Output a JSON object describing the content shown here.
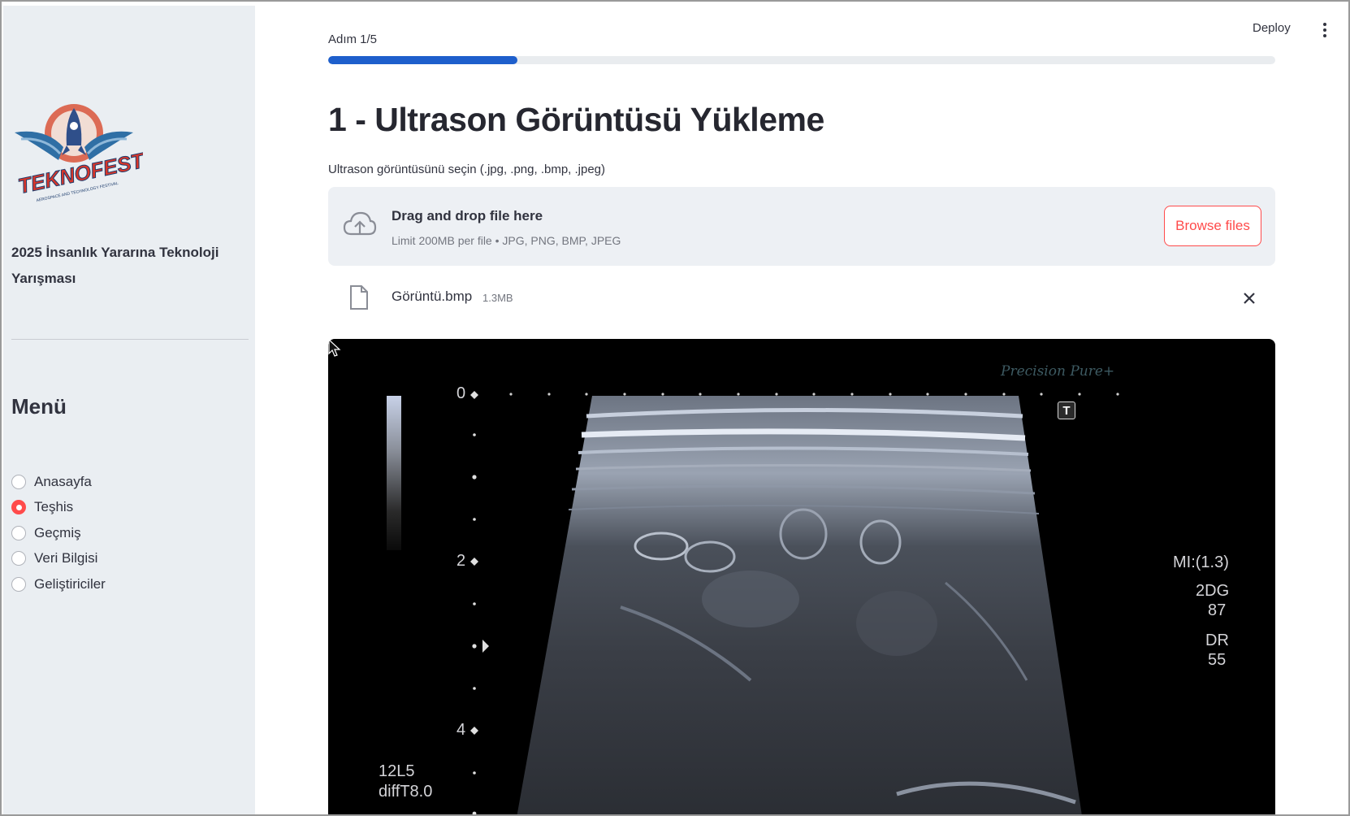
{
  "header": {
    "deploy_label": "Deploy",
    "menu_icon": "kebab-menu-icon"
  },
  "sidebar": {
    "logo_icon": "teknofest-logo-icon",
    "logo_text": "TEKNOFEST",
    "logo_subtext": "AEROSPACE AND TECHNOLOGY FESTIVAL",
    "title": "2025 İnsanlık Yararına Teknoloji Yarışması",
    "menu_title": "Menü",
    "menu_items": [
      {
        "label": "Anasayfa",
        "selected": false
      },
      {
        "label": "Teşhis",
        "selected": true
      },
      {
        "label": "Geçmiş",
        "selected": false
      },
      {
        "label": "Veri Bilgisi",
        "selected": false
      },
      {
        "label": "Geliştiriciler",
        "selected": false
      }
    ]
  },
  "progress": {
    "step_label": "Adım 1/5",
    "fraction": 0.2
  },
  "main": {
    "title": "1 - Ultrason Görüntüsü Yükleme",
    "upload_label": "Ultrason görüntüsünü seçin (.jpg, .png, .bmp, .jpeg)",
    "dropzone": {
      "icon": "cloud-upload-icon",
      "main_text": "Drag and drop file here",
      "sub_text": "Limit 200MB per file • JPG, PNG, BMP, JPEG",
      "browse_label": "Browse files"
    },
    "uploaded_file": {
      "icon": "file-icon",
      "name": "Görüntü.bmp",
      "size": "1.3MB",
      "remove_icon": "close-icon"
    }
  },
  "ultrasound": {
    "brand": "Precision    Pure+",
    "t_label": "T",
    "depth_labels": [
      "0",
      "2",
      "4"
    ],
    "mi": "MI:(1.3)",
    "mode": "2DG",
    "gain": "87",
    "dr_label": "DR",
    "dr_value": "55",
    "probe": "12L5",
    "preset": "diffT8.0"
  },
  "colors": {
    "accent": "#ff4b4b",
    "progress": "#1e5fcc",
    "sidebar_bg": "#eaeef2",
    "dropzone_bg": "#edf0f4"
  }
}
